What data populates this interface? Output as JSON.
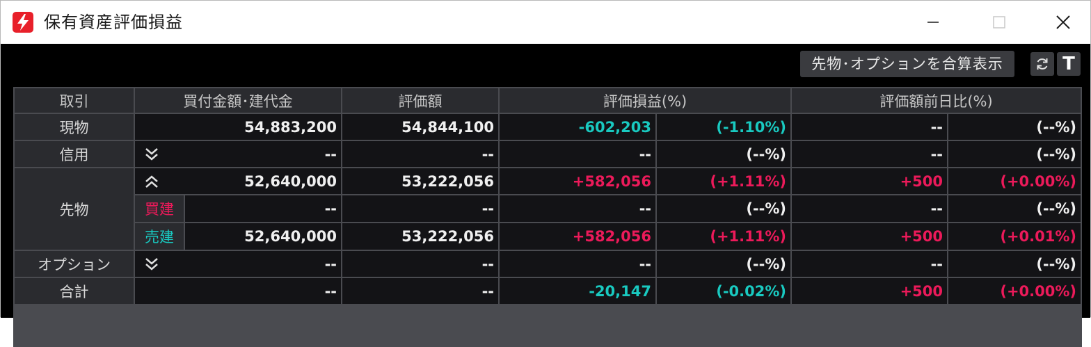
{
  "window": {
    "title": "保有資産評価損益",
    "app_icon": "lightning-bolt-icon",
    "controls": [
      "minimize-icon",
      "maximize-icon",
      "close-icon"
    ]
  },
  "toolbar": {
    "combine_label": "先物･オプションを合算表示",
    "refresh_icon": "refresh-icon",
    "text_label": "T"
  },
  "colors": {
    "positive": "#ec1a5a",
    "negative": "#19c9c0",
    "neutral": "#f0f0f0",
    "header_bg": "#2a2b2f",
    "cell_bg": "#131316"
  },
  "table": {
    "headers": {
      "col1": "取引",
      "col2": "買付金額･建代金",
      "col3": "評価額",
      "col4": "評価損益(%)",
      "col5": "評価額前日比(%)"
    },
    "rows": {
      "genbutsu": {
        "label": "現物",
        "amount": "54,883,200",
        "value": "54,844,100",
        "pl": "-602,203",
        "pl_pct": "(-1.10%)",
        "day": "--",
        "day_pct": "(--%)"
      },
      "shinyo": {
        "label": "信用",
        "toggle": "expand",
        "amount": "--",
        "value": "--",
        "pl": "--",
        "pl_pct": "(--%)",
        "day": "--",
        "day_pct": "(--%)"
      },
      "sakimono": {
        "label": "先物",
        "toggle": "collapse",
        "amount": "52,640,000",
        "value": "53,222,056",
        "pl": "+582,056",
        "pl_pct": "(+1.11%)",
        "day": "+500",
        "day_pct": "(+0.00%)"
      },
      "kaidate": {
        "label": "買建",
        "amount": "--",
        "value": "--",
        "pl": "--",
        "pl_pct": "(--%)",
        "day": "--",
        "day_pct": "(--%)"
      },
      "uridate": {
        "label": "売建",
        "amount": "52,640,000",
        "value": "53,222,056",
        "pl": "+582,056",
        "pl_pct": "(+1.11%)",
        "day": "+500",
        "day_pct": "(+0.01%)"
      },
      "option": {
        "label": "オプション",
        "toggle": "expand",
        "amount": "--",
        "value": "--",
        "pl": "--",
        "pl_pct": "(--%)",
        "day": "--",
        "day_pct": "(--%)"
      },
      "total": {
        "label": "合計",
        "amount": "--",
        "value": "--",
        "pl": "-20,147",
        "pl_pct": "(-0.02%)",
        "day": "+500",
        "day_pct": "(+0.00%)"
      }
    }
  }
}
